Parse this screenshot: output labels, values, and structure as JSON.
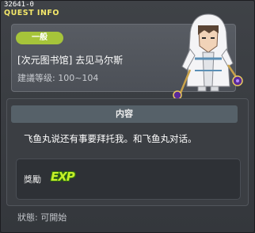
{
  "header": {
    "quest_id": "32641-0",
    "title": "QUEST INFO"
  },
  "quest": {
    "badge": "一般",
    "name": "[次元图书馆] 去见马尔斯",
    "level": "建議等级: 100~104"
  },
  "content": {
    "header": "内容",
    "text": "飞鱼丸说还有事要拜托我。和飞鱼丸对话。"
  },
  "reward": {
    "label": "獎勵",
    "exp_label": "EXP"
  },
  "status": "狀態: 可開始",
  "colors": {
    "badge": "#a6c43a",
    "title": "#f4e86a",
    "exp": "#c6f028"
  },
  "icons": {
    "npc": "npc-portrait-white-hooded-mage",
    "exp": "exp-icon"
  }
}
